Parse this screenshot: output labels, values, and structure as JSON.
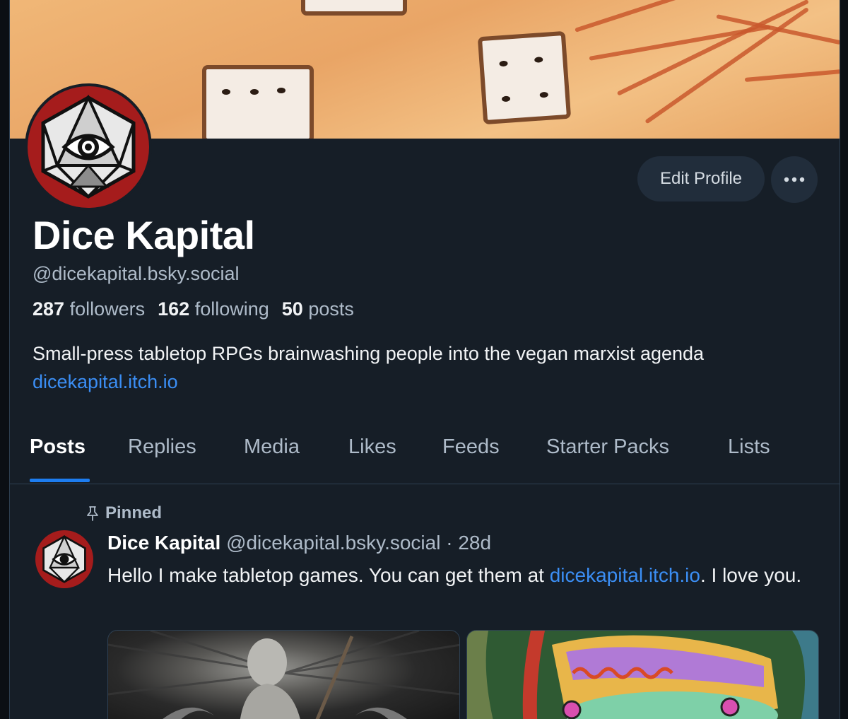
{
  "profile": {
    "name": "Dice Kapital",
    "handle": "@dicekapital.bsky.social",
    "stats": {
      "followers_count": "287",
      "followers_label": "followers",
      "following_count": "162",
      "following_label": "following",
      "posts_count": "50",
      "posts_label": "posts"
    },
    "bio": "Small-press tabletop RPGs brainwashing people into the vegan marxist agenda",
    "bio_link": "dicekapital.itch.io"
  },
  "actions": {
    "edit_profile_label": "Edit Profile",
    "more_icon": "ellipsis-icon"
  },
  "tabs": [
    {
      "label": "Posts",
      "active": true
    },
    {
      "label": "Replies",
      "active": false
    },
    {
      "label": "Media",
      "active": false
    },
    {
      "label": "Likes",
      "active": false
    },
    {
      "label": "Feeds",
      "active": false
    },
    {
      "label": "Starter Packs",
      "active": false
    },
    {
      "label": "Lists",
      "active": false
    }
  ],
  "pinned_post": {
    "pinned_label": "Pinned",
    "author_name": "Dice Kapital",
    "author_handle": "@dicekapital.bsky.social",
    "separator": "·",
    "time": "28d",
    "text_before": "Hello I make tabletop games. You can get them at ",
    "text_link": "dicekapital.itch.io",
    "text_after": ". I love you."
  },
  "icons": {
    "avatar": "eye-d20-icon",
    "pin": "pin-icon"
  },
  "colors": {
    "background": "#161e27",
    "accent": "#1d7df0",
    "link": "#3b8ef4",
    "avatar_ring": "#a51c1c"
  }
}
